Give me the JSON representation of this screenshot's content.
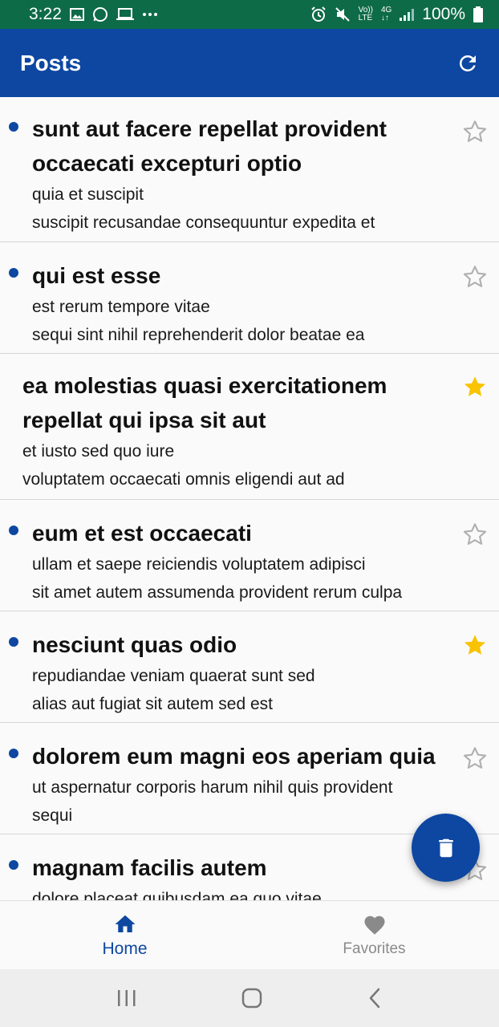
{
  "status_bar": {
    "time": "3:22",
    "volte_top": "Vo))",
    "volte_bottom": "LTE",
    "network": "4G",
    "battery": "100%"
  },
  "app_bar": {
    "title": "Posts"
  },
  "posts": [
    {
      "title": "sunt aut facere repellat provident occaecati excepturi optio",
      "body_line1": "quia et suscipit",
      "body_line2": "suscipit recusandae consequuntur expedita et",
      "unread": true,
      "favorite": false
    },
    {
      "title": "qui est esse",
      "body_line1": "est rerum tempore vitae",
      "body_line2": "sequi sint nihil reprehenderit dolor beatae ea",
      "unread": true,
      "favorite": false
    },
    {
      "title": "ea molestias quasi exercitationem repellat qui ipsa sit aut",
      "body_line1": "et iusto sed quo iure",
      "body_line2": "voluptatem occaecati omnis eligendi aut ad",
      "unread": false,
      "favorite": true
    },
    {
      "title": "eum et est occaecati",
      "body_line1": "ullam et saepe reiciendis voluptatem adipisci",
      "body_line2": "sit amet autem assumenda provident rerum culpa",
      "unread": true,
      "favorite": false
    },
    {
      "title": "nesciunt quas odio",
      "body_line1": "repudiandae veniam quaerat sunt sed",
      "body_line2": "alias aut fugiat sit autem sed est",
      "unread": true,
      "favorite": true
    },
    {
      "title": "dolorem eum magni eos aperiam quia",
      "body_line1": "ut aspernatur corporis harum nihil quis provident",
      "body_line2": "sequi",
      "unread": true,
      "favorite": false
    },
    {
      "title": "magnam facilis autem",
      "body_line1": "dolore placeat quibusdam ea quo vitae",
      "body_line2": "",
      "unread": true,
      "favorite": false
    }
  ],
  "fab": {
    "icon": "trash-icon"
  },
  "bottom_nav": {
    "home_label": "Home",
    "favorites_label": "Favorites"
  },
  "colors": {
    "primary": "#0d47a1",
    "status_bar": "#0e6b47",
    "star_active": "#f9c300",
    "star_inactive": "#b0b0b0"
  }
}
